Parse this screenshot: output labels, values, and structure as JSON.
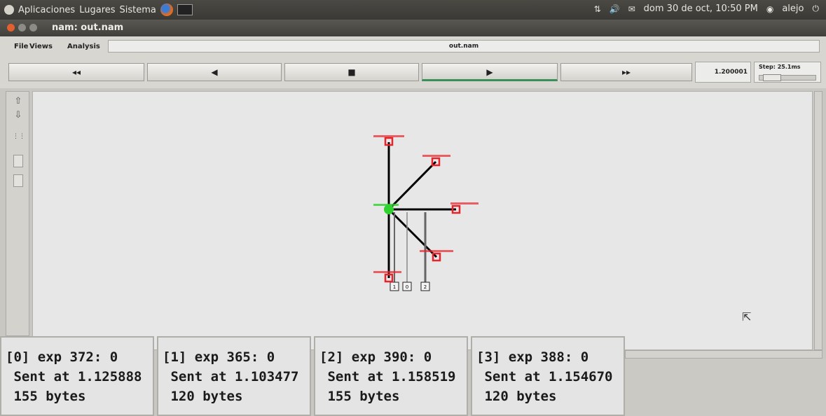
{
  "panel": {
    "menus": [
      "Aplicaciones",
      "Lugares",
      "Sistema"
    ],
    "clock": "dom 30 de oct, 10:50 PM",
    "user": "alejo"
  },
  "window": {
    "title": "nam: out.nam"
  },
  "menu": {
    "file": "File",
    "views": "Views",
    "analysis": "Analysis",
    "filename": "out.nam"
  },
  "controls": {
    "rewind": "◂◂",
    "back": "◀",
    "stop": "■",
    "play": "▶",
    "forward": "▸▸",
    "time": "1.200001",
    "step": "Step: 25.1ms"
  },
  "packets": [
    {
      "line1": "[0] exp 372: 0",
      "line2": " Sent at 1.125888",
      "line3": " 155 bytes"
    },
    {
      "line1": "[1] exp 365: 0",
      "line2": " Sent at 1.103477",
      "line3": " 120 bytes"
    },
    {
      "line1": "[2] exp 390: 0",
      "line2": " Sent at 1.158519",
      "line3": " 155 bytes"
    },
    {
      "line1": "[3] exp 388: 0",
      "line2": " Sent at 1.154670",
      "line3": " 120 bytes"
    }
  ],
  "queues": [
    "1",
    "0",
    "2"
  ],
  "colors": {
    "node_red": "#e8232a",
    "node_green": "#2fd12f",
    "play_accent": "#3d8f5a"
  }
}
